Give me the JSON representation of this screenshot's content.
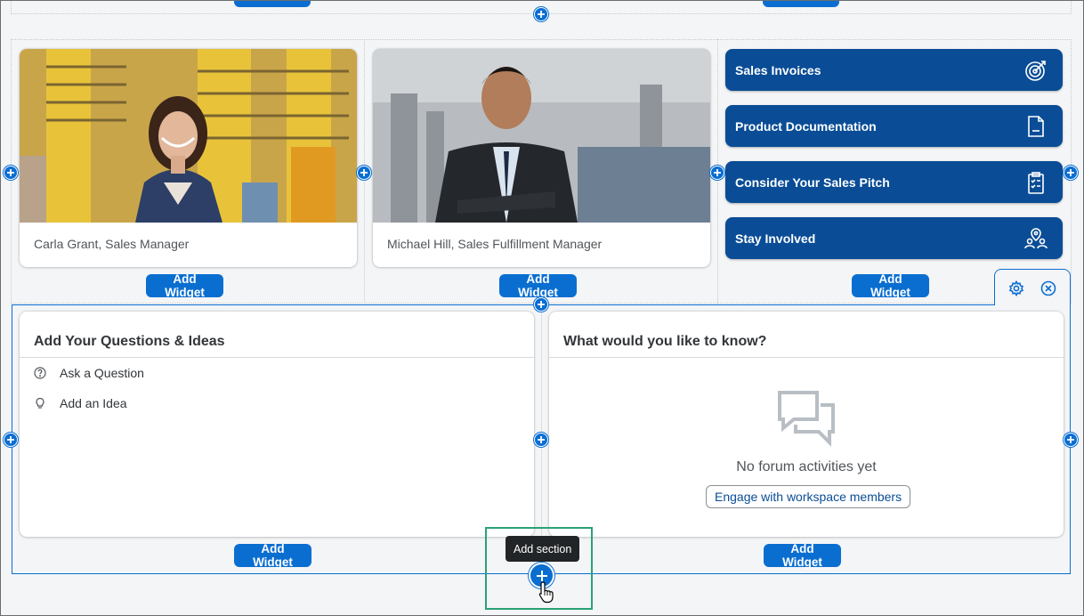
{
  "colors": {
    "accent": "#0a6ed1",
    "tile_bg": "#0a4d96",
    "highlight": "#2aa174",
    "page_bg": "#f4f5f7"
  },
  "section1": {
    "people": [
      {
        "caption": "Carla Grant, Sales Manager"
      },
      {
        "caption": "Michael Hill, Sales Fulfillment Manager"
      }
    ],
    "tiles": [
      {
        "label": "Sales Invoices",
        "icon": "target-icon"
      },
      {
        "label": "Product Documentation",
        "icon": "document-icon"
      },
      {
        "label": "Consider Your Sales Pitch",
        "icon": "clipboard-checklist-icon"
      },
      {
        "label": "Stay Involved",
        "icon": "people-location-icon"
      }
    ],
    "add_widget": "Add Widget"
  },
  "section2": {
    "questions_panel": {
      "title": "Add Your Questions & Ideas",
      "items": [
        {
          "label": "Ask a Question",
          "icon": "question-circle-icon"
        },
        {
          "label": "Add an Idea",
          "icon": "lightbulb-icon"
        }
      ]
    },
    "forum_panel": {
      "title": "What would you like to know?",
      "empty_text": "No forum activities yet",
      "engage_label": "Engage with workspace members",
      "icon": "discussion-icon"
    },
    "add_widget": "Add Widget",
    "tools": [
      "settings-icon",
      "close-circle-icon"
    ]
  },
  "tooltip": {
    "text": "Add section"
  }
}
